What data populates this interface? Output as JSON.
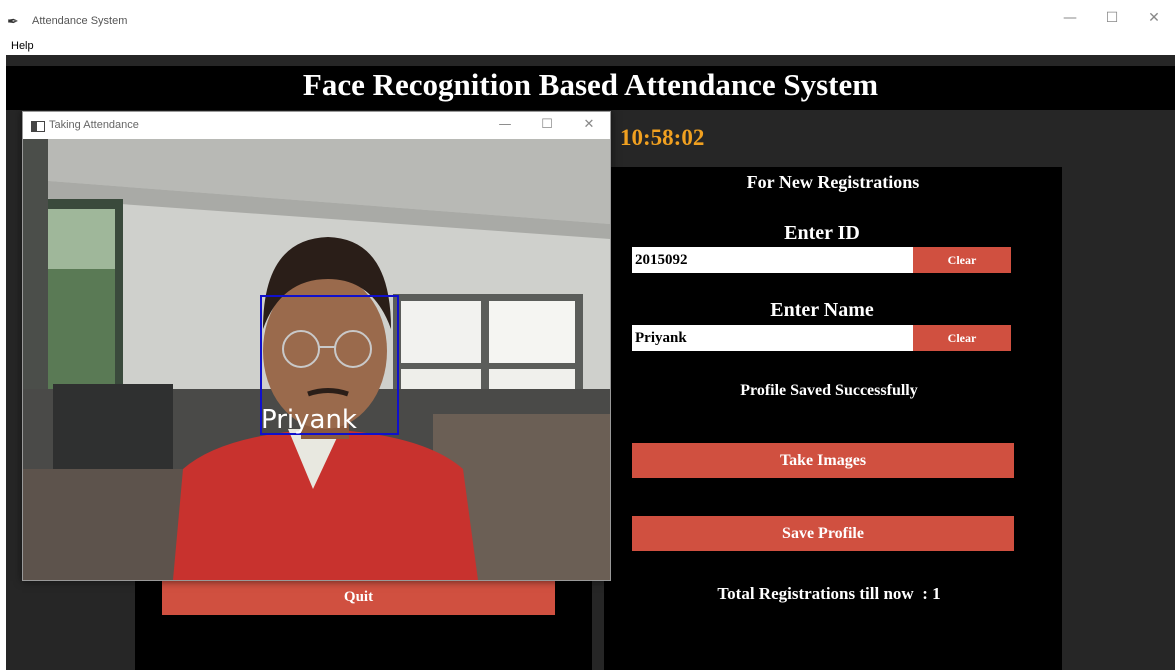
{
  "window": {
    "title": "Attendance System",
    "icon": "feather-icon",
    "controls": [
      "—",
      "☐",
      "✕"
    ]
  },
  "menu": {
    "help": "Help"
  },
  "header": {
    "title": "Face Recognition Based Attendance System",
    "clock": "10:58:02"
  },
  "camera_window": {
    "title": "Taking Attendance",
    "controls": [
      "—",
      "☐",
      "✕"
    ],
    "detected_name": "Priyank"
  },
  "left_panel": {
    "quit_label": "Quit"
  },
  "registration": {
    "heading": "For New Registrations",
    "id_label": "Enter ID",
    "id_value": "2015092",
    "id_clear_label": "Clear",
    "name_label": "Enter Name",
    "name_value": "Priyank",
    "name_clear_label": "Clear",
    "status_message": "Profile Saved Successfully",
    "take_images_label": "Take Images",
    "save_profile_label": "Save Profile",
    "total_label": "Total Registrations till now  : 1"
  },
  "colors": {
    "background": "#262626",
    "panel": "#000000",
    "button": "#d05040",
    "clock": "#f0a020",
    "face_box": "#1010cc"
  }
}
